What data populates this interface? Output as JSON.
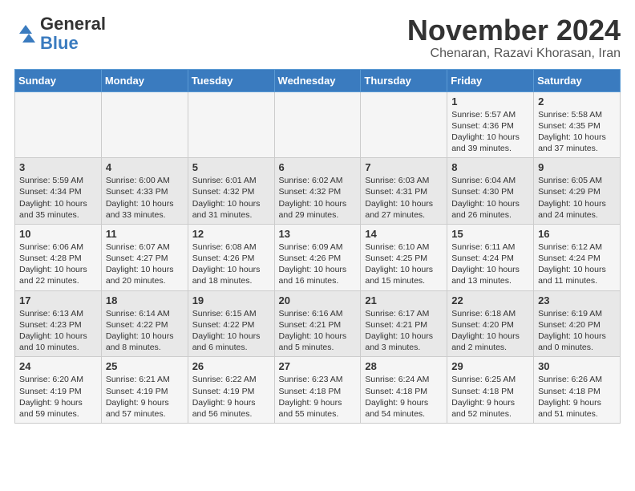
{
  "logo": {
    "general": "General",
    "blue": "Blue"
  },
  "title": "November 2024",
  "subtitle": "Chenaran, Razavi Khorasan, Iran",
  "days_of_week": [
    "Sunday",
    "Monday",
    "Tuesday",
    "Wednesday",
    "Thursday",
    "Friday",
    "Saturday"
  ],
  "weeks": [
    [
      {
        "day": "",
        "info": ""
      },
      {
        "day": "",
        "info": ""
      },
      {
        "day": "",
        "info": ""
      },
      {
        "day": "",
        "info": ""
      },
      {
        "day": "",
        "info": ""
      },
      {
        "day": "1",
        "info": "Sunrise: 5:57 AM\nSunset: 4:36 PM\nDaylight: 10 hours and 39 minutes."
      },
      {
        "day": "2",
        "info": "Sunrise: 5:58 AM\nSunset: 4:35 PM\nDaylight: 10 hours and 37 minutes."
      }
    ],
    [
      {
        "day": "3",
        "info": "Sunrise: 5:59 AM\nSunset: 4:34 PM\nDaylight: 10 hours and 35 minutes."
      },
      {
        "day": "4",
        "info": "Sunrise: 6:00 AM\nSunset: 4:33 PM\nDaylight: 10 hours and 33 minutes."
      },
      {
        "day": "5",
        "info": "Sunrise: 6:01 AM\nSunset: 4:32 PM\nDaylight: 10 hours and 31 minutes."
      },
      {
        "day": "6",
        "info": "Sunrise: 6:02 AM\nSunset: 4:32 PM\nDaylight: 10 hours and 29 minutes."
      },
      {
        "day": "7",
        "info": "Sunrise: 6:03 AM\nSunset: 4:31 PM\nDaylight: 10 hours and 27 minutes."
      },
      {
        "day": "8",
        "info": "Sunrise: 6:04 AM\nSunset: 4:30 PM\nDaylight: 10 hours and 26 minutes."
      },
      {
        "day": "9",
        "info": "Sunrise: 6:05 AM\nSunset: 4:29 PM\nDaylight: 10 hours and 24 minutes."
      }
    ],
    [
      {
        "day": "10",
        "info": "Sunrise: 6:06 AM\nSunset: 4:28 PM\nDaylight: 10 hours and 22 minutes."
      },
      {
        "day": "11",
        "info": "Sunrise: 6:07 AM\nSunset: 4:27 PM\nDaylight: 10 hours and 20 minutes."
      },
      {
        "day": "12",
        "info": "Sunrise: 6:08 AM\nSunset: 4:26 PM\nDaylight: 10 hours and 18 minutes."
      },
      {
        "day": "13",
        "info": "Sunrise: 6:09 AM\nSunset: 4:26 PM\nDaylight: 10 hours and 16 minutes."
      },
      {
        "day": "14",
        "info": "Sunrise: 6:10 AM\nSunset: 4:25 PM\nDaylight: 10 hours and 15 minutes."
      },
      {
        "day": "15",
        "info": "Sunrise: 6:11 AM\nSunset: 4:24 PM\nDaylight: 10 hours and 13 minutes."
      },
      {
        "day": "16",
        "info": "Sunrise: 6:12 AM\nSunset: 4:24 PM\nDaylight: 10 hours and 11 minutes."
      }
    ],
    [
      {
        "day": "17",
        "info": "Sunrise: 6:13 AM\nSunset: 4:23 PM\nDaylight: 10 hours and 10 minutes."
      },
      {
        "day": "18",
        "info": "Sunrise: 6:14 AM\nSunset: 4:22 PM\nDaylight: 10 hours and 8 minutes."
      },
      {
        "day": "19",
        "info": "Sunrise: 6:15 AM\nSunset: 4:22 PM\nDaylight: 10 hours and 6 minutes."
      },
      {
        "day": "20",
        "info": "Sunrise: 6:16 AM\nSunset: 4:21 PM\nDaylight: 10 hours and 5 minutes."
      },
      {
        "day": "21",
        "info": "Sunrise: 6:17 AM\nSunset: 4:21 PM\nDaylight: 10 hours and 3 minutes."
      },
      {
        "day": "22",
        "info": "Sunrise: 6:18 AM\nSunset: 4:20 PM\nDaylight: 10 hours and 2 minutes."
      },
      {
        "day": "23",
        "info": "Sunrise: 6:19 AM\nSunset: 4:20 PM\nDaylight: 10 hours and 0 minutes."
      }
    ],
    [
      {
        "day": "24",
        "info": "Sunrise: 6:20 AM\nSunset: 4:19 PM\nDaylight: 9 hours and 59 minutes."
      },
      {
        "day": "25",
        "info": "Sunrise: 6:21 AM\nSunset: 4:19 PM\nDaylight: 9 hours and 57 minutes."
      },
      {
        "day": "26",
        "info": "Sunrise: 6:22 AM\nSunset: 4:19 PM\nDaylight: 9 hours and 56 minutes."
      },
      {
        "day": "27",
        "info": "Sunrise: 6:23 AM\nSunset: 4:18 PM\nDaylight: 9 hours and 55 minutes."
      },
      {
        "day": "28",
        "info": "Sunrise: 6:24 AM\nSunset: 4:18 PM\nDaylight: 9 hours and 54 minutes."
      },
      {
        "day": "29",
        "info": "Sunrise: 6:25 AM\nSunset: 4:18 PM\nDaylight: 9 hours and 52 minutes."
      },
      {
        "day": "30",
        "info": "Sunrise: 6:26 AM\nSunset: 4:18 PM\nDaylight: 9 hours and 51 minutes."
      }
    ]
  ]
}
